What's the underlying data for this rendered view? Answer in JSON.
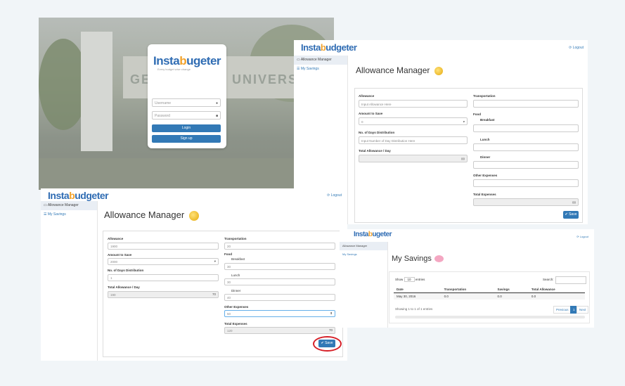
{
  "login": {
    "logo": "Instabugeter",
    "tagline": "Every budget wise change",
    "sign_text_left": "GEN",
    "sign_text_right": "UNIVERSITY",
    "username_placeholder": "Username",
    "password_placeholder": "Password",
    "username_icon": "user-icon",
    "password_icon": "lock-icon",
    "login_label": "Login",
    "signup_label": "Sign up"
  },
  "app_blank": {
    "logo": "Instabudgeter",
    "logout": "⟳ Logout",
    "sidebar": [
      {
        "icon": "▭",
        "label": "Allowance Manager",
        "active": true
      },
      {
        "icon": "☰",
        "label": "My Savings",
        "active": false
      }
    ],
    "title": "Allowance Manager",
    "left_fields": {
      "allowance_label": "Allowance",
      "allowance_placeholder": "Input Allowance Here",
      "amount_save_label": "Amount to Save",
      "amount_save_value": "0",
      "days_label": "No. of Days Distribution",
      "days_placeholder": "Input Number of Day Distribution Here",
      "total_per_day_label": "Total Allowance / Day",
      "total_per_day_value": "00"
    },
    "right_fields": {
      "transportation_label": "Transportation",
      "food_label": "Food",
      "breakfast_label": "Breakfast",
      "lunch_label": "Lunch",
      "dinner_label": "Dinner",
      "other_label": "Other Expenses",
      "total_label": "Total Expenses",
      "total_value": "00"
    },
    "save_label": "✔ Save"
  },
  "app_filled": {
    "logo": "Instabudgeter",
    "logout": "⟳ Logout",
    "sidebar": [
      {
        "icon": "▭",
        "label": "Allowance Manager",
        "active": true
      },
      {
        "icon": "☰",
        "label": "My Savings",
        "active": false
      }
    ],
    "title": "Allowance Manager",
    "left_fields": {
      "allowance_label": "Allowance",
      "allowance_value": "1900",
      "amount_save_label": "Amount to Save",
      "amount_save_value": "2000",
      "days_label": "No. of Days Distribution",
      "days_value": "1",
      "total_per_day_label": "Total Allowance / Day",
      "total_per_day_value": "190",
      "total_per_day_right": "70"
    },
    "right_fields": {
      "transportation_label": "Transportation",
      "transportation_value": "20",
      "food_label": "Food",
      "breakfast_label": "Breakfast",
      "breakfast_value": "30",
      "lunch_label": "Lunch",
      "lunch_value": "30",
      "dinner_label": "Dinner",
      "dinner_value": "40",
      "other_label": "Other Expenses",
      "other_value": "50",
      "total_label": "Total Expenses",
      "total_value": "120",
      "total_right": "70"
    },
    "save_label": "✔ Save"
  },
  "savings": {
    "logo": "Instabugeter",
    "logout": "⟳ Logout",
    "sidebar": [
      {
        "label": "Allowance Manager",
        "active": true
      },
      {
        "label": "My Savings",
        "active": false
      }
    ],
    "title": "My Savings",
    "show_label": "Show",
    "show_value": "10",
    "entries_label": "entries",
    "search_label": "Search:",
    "columns": [
      "Date",
      "Transportation",
      "Savings",
      "Total Allowance"
    ],
    "rows": [
      [
        "May 30, 2016",
        "0.0",
        "0.0",
        "0.0"
      ]
    ],
    "info": "Showing 1 to 1 of 1 entries",
    "prev_label": "Previous",
    "page_label": "1",
    "next_label": "Next"
  },
  "colors": {
    "brand_blue": "#3279b6",
    "highlight_red": "#d61f27",
    "coin_gold": "#e5a90b",
    "piggy_pink": "#f4a7c2"
  }
}
